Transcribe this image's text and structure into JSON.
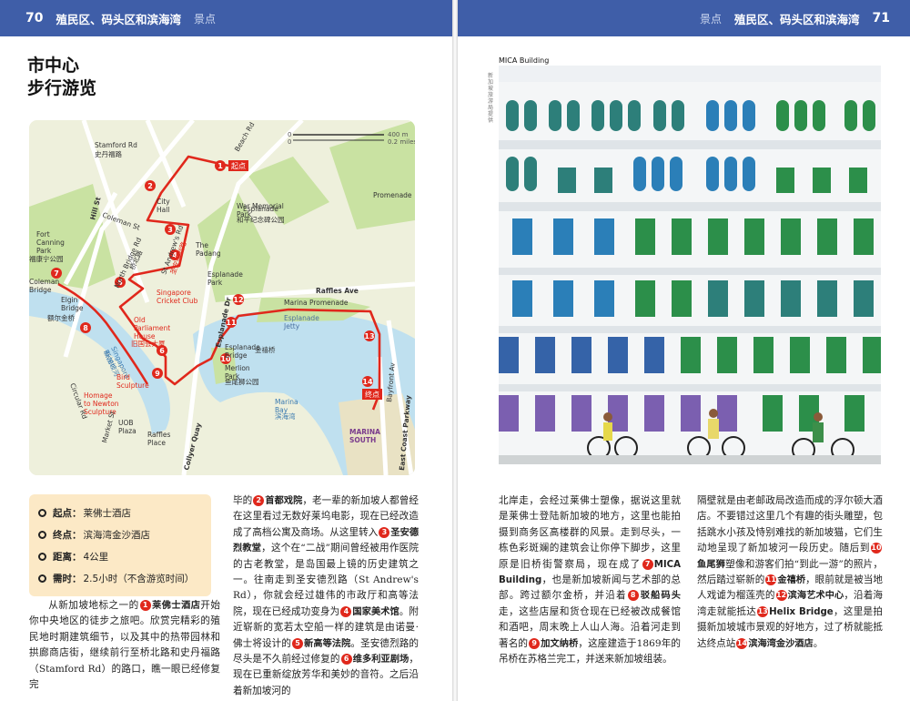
{
  "header_left": {
    "page": "70",
    "chapter": "殖民区、码头区和滨海湾",
    "section": "景点"
  },
  "header_right": {
    "page": "71",
    "chapter": "殖民区、码头区和滨海湾",
    "section": "景点"
  },
  "title": {
    "line1": "市中心",
    "line2": "步行游览"
  },
  "map": {
    "scale": {
      "km": "400 m",
      "km0": "0",
      "mi": "0.2 miles",
      "mi0": "0"
    },
    "labels": {
      "stamford": "Stamford Rd",
      "stamford_cn": "史丹福路",
      "beach": "Beach Rd",
      "hill": "Hill St",
      "city_hall": "City\nHall",
      "coleman": "Coleman St",
      "north_bridge": "North Bridge Rd",
      "north_bridge_cn": "桥北路",
      "st_andrews": "St Andrew's Rd",
      "st_andrews_cn": "圣安德烈路",
      "padang": "The\nPadang",
      "esplanade": "Esplanade",
      "war_memorial": "War Memorial\nPark",
      "war_memorial_cn": "和平纪念碑公园",
      "promenade": "Promenade",
      "fort_canning": "Fort\nCanning\nPark",
      "fort_canning_cn": "福康宁公园",
      "cricket": "Singapore\nCricket Club",
      "esplanade_park": "Esplanade\nPark",
      "raffles_ave": "Raffles Ave",
      "marina_prom": "Marina Promenade",
      "esplanade_dr": "Esplanade Dr",
      "coleman_bridge": "Coleman\nBridge",
      "elgin": "Elgin\nBridge",
      "elgin_cn": "额尔金桥",
      "old_parliament": "Old\nParliament\nHouse",
      "old_parliament_cn": "旧国会大厦",
      "esplanade_bridge": "Esplanade\nBridge",
      "esplanade_bridge_cn": "金禧桥",
      "esplanade_jetty": "Esplanade\nJetty",
      "merlion": "Merlion\nPark",
      "merlion_cn": "鱼尾狮公园",
      "singapore_river": "Singapore\nRiver",
      "singapore_river_cn": "新加坡河",
      "circular": "Circular Rd",
      "bird": "Bird\nSculpture",
      "homage": "Homage\nto Newton\nSculpture",
      "uob": "UOB\nPlaza",
      "market": "Market St",
      "raffles_place": "Raffles\nPlace",
      "collyer": "Collyer Quay",
      "marina_bay": "Marina\nBay",
      "marina_bay_cn": "滨海湾",
      "bayfront": "Bayfront Av",
      "east_coast": "East Coast Parkway",
      "marina_south": "MARINA\nSOUTH",
      "start": "起点",
      "end": "终点"
    },
    "stops": [
      "1",
      "2",
      "3",
      "4",
      "5",
      "6",
      "7",
      "8",
      "9",
      "10",
      "11",
      "12",
      "13",
      "14"
    ]
  },
  "info": {
    "start_label": "起点：",
    "start": "莱佛士酒店",
    "end_label": "终点：",
    "end": "滨海湾金沙酒店",
    "dist_label": "距离：",
    "dist": "4公里",
    "time_label": "需时：",
    "time": "2.5小时（不含游览时间）"
  },
  "col1": {
    "t1": "从新加坡地标之一的",
    "k1": "莱佛士酒店",
    "t2": "开始你中央地区的徒步之旅吧。欣赏完精彩的殖民地时期建筑细节，以及其中的热带园林和拱廊商店街，继续前行至桥北路和史丹福路（Stamford Rd）的路口，瞧一眼已经修复完"
  },
  "col2": {
    "t1": "毕的",
    "k2": "首都戏院",
    "t2": "，老一辈的新加坡人都曾经在这里看过无数好莱坞电影，现在已经改造成了高档公寓及商场。从这里转入",
    "k3": "圣安德烈教堂",
    "t3": "，这个在“二战”期间曾经被用作医院的古老教堂，是岛国最上镜的历史建筑之一。往南走到圣安德烈路（St Andrew's Rd），你就会经过雄伟的市政厅和高等法院，现在已经成功变身为",
    "k4": "国家美术馆",
    "t4": "。附近崭新的宽若太空船一样的建筑是由诺曼·佛士将设计的",
    "k5": "新高等法院",
    "t5": "。圣安德烈路的尽头是不久前经过修复的",
    "k6": "维多利亚剧场",
    "t6": "，现在已重新绽放芳华和美妙的音符。之后沿着新加坡河的"
  },
  "col3": {
    "t1": "北岸走，会经过莱佛士塑像，据说这里就是莱佛士登陆新加坡的地方，这里也能拍摄到商务区高楼群的风景。走到尽头，一栋色彩斑斓的建筑会让你停下脚步，这里原是旧桥街警察局，现在成了",
    "k7": "MICA Building",
    "t2": "，也是新加坡新闻与艺术部的总部。跨过额尔金桥，并沿着",
    "k8": "驳船码头",
    "t3": "走，这些店屋和货仓现在已经被改成餐馆和酒吧，周末晚上人山人海。沿着河走到著名的",
    "k9": "加文纳桥",
    "t4": "，这座建造于1869年的吊桥在苏格兰完工，并送来新加坡组装。"
  },
  "col4": {
    "t1": "隔壁就是由老邮政局改造而成的浮尔顿大酒店。不要错过这里几个有趣的街头雕塑，包括跳水小孩及恃别难找的新加坡猫，它们生动地呈现了新加坡河一段历史。随后到",
    "k10": "鱼尾狮",
    "t2": "塑像和游客们拍“到此一游”的照片，然后踏过崭新的",
    "k11": "金禧桥",
    "t3": "，眼前就是被当地人戏谑为榴莲壳的",
    "k12": "滨海艺术中心",
    "t4": "，沿着海湾走就能抵达",
    "k13": "Helix Bridge",
    "t5": "，这里是拍摄新加坡城市景观的好地方，过了桥就能抵达终点站",
    "k14": "滨海湾金沙酒店",
    "t6": "。"
  },
  "photo": {
    "label": "MICA Building",
    "credit": "新加坡旅游局提供"
  },
  "colors": {
    "header": "#3f5ea8",
    "route": "#e0281c",
    "info_bg": "#fce9c6"
  }
}
